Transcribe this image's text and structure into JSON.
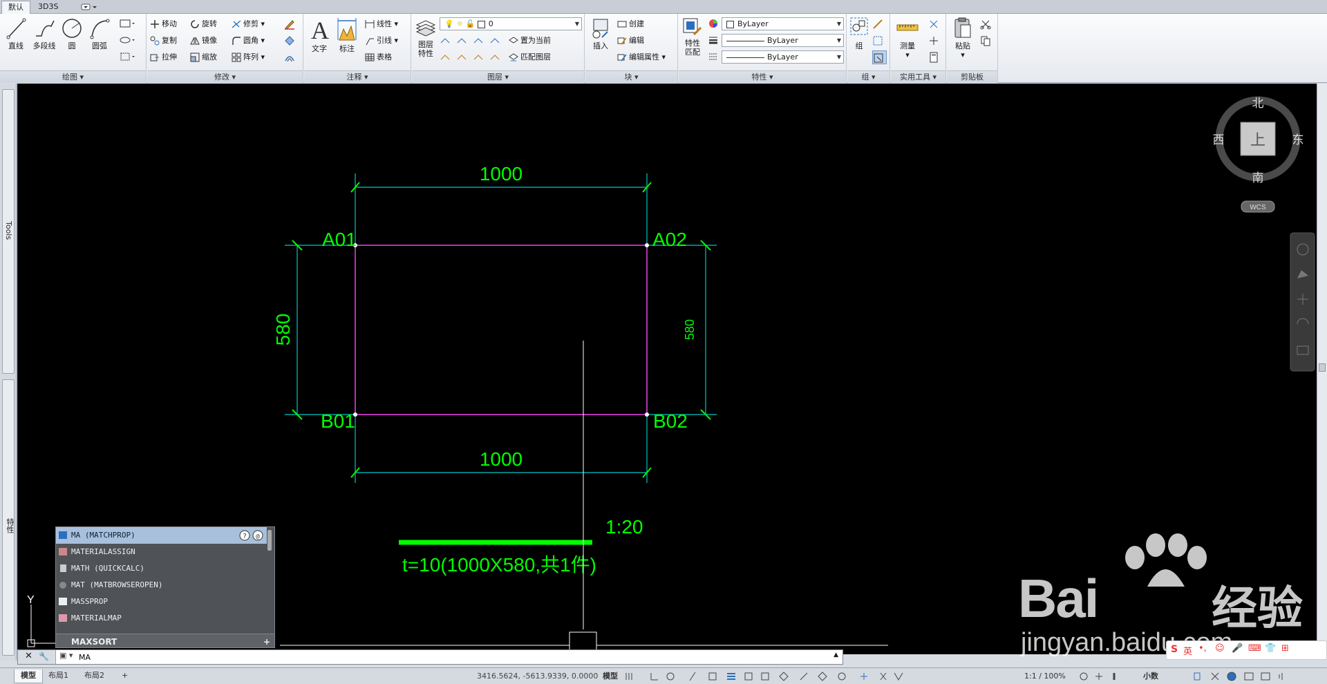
{
  "tabs": {
    "default": "默认",
    "threeds": "3D3S"
  },
  "ribbon": {
    "draw": {
      "title": "绘图",
      "line": "直线",
      "polyline": "多段线",
      "circle": "圆",
      "arc": "圆弧"
    },
    "modify": {
      "title": "修改",
      "move": "移动",
      "rotate": "旋转",
      "trim": "修剪",
      "copy": "复制",
      "mirror": "镜像",
      "fillet": "圆角",
      "stretch": "拉伸",
      "scale": "缩放",
      "array": "阵列"
    },
    "annotation": {
      "title": "注释",
      "text": "文字",
      "dimension": "标注",
      "linear": "线性",
      "leader": "引线",
      "table": "表格"
    },
    "layers": {
      "title": "图层",
      "layer_props_1": "图层",
      "layer_props_2": "特性",
      "current_layer": "0",
      "set_current": "置为当前",
      "match_layer": "匹配图层"
    },
    "block": {
      "title": "块",
      "insert": "插入",
      "create": "创建",
      "edit": "编辑",
      "edit_attributes": "编辑属性"
    },
    "properties": {
      "title": "特性",
      "match_1": "特性",
      "match_2": "匹配",
      "color": "ByLayer",
      "linetype": "ByLayer",
      "lineweight": "ByLayer"
    },
    "groups": {
      "title": "组",
      "group": "组"
    },
    "utilities": {
      "title": "实用工具",
      "measure": "测量"
    },
    "clipboard": {
      "title": "剪贴板",
      "paste": "粘贴"
    }
  },
  "side": {
    "tools": "Tools",
    "properties": "特性"
  },
  "viewcube": {
    "north": "北",
    "south": "南",
    "east": "东",
    "west": "西",
    "top": "上",
    "wcs": "WCS"
  },
  "drawing": {
    "dim_top": "1000",
    "dim_bottom": "1000",
    "dim_left": "580",
    "dim_right": "580",
    "label_a01": "A01",
    "label_a02": "A02",
    "label_b01": "B01",
    "label_b02": "B02",
    "scale": "1:20",
    "plate_note": "t=10(1000X580,共1件)",
    "ucs_y": "Y"
  },
  "autocomplete": {
    "items": [
      "MA (MATCHPROP)",
      "MATERIALASSIGN",
      "MATH (QUICKCALC)",
      "MAT (MATBROWSEROPEN)",
      "MASSPROP",
      "MATERIALMAP"
    ],
    "header": "MAXSORT"
  },
  "command": {
    "value": "MA"
  },
  "status": {
    "model_tab": "模型",
    "layout1": "布局1",
    "layout2": "布局2",
    "add": "+",
    "coords": "3416.5624, -5613.9339, 0.0000",
    "model_btn": "模型",
    "zoom": "1:1 / 100%",
    "units": "小数"
  },
  "watermark": {
    "brand_1": "Bai",
    "brand_2": "经验",
    "url": "jingyan.baidu.com"
  },
  "ime": {
    "lang": "英"
  },
  "colors": {
    "cyan": "#00c8c8",
    "green": "#00ff00",
    "magenta": "#e040e0",
    "canvas": "#000000"
  }
}
